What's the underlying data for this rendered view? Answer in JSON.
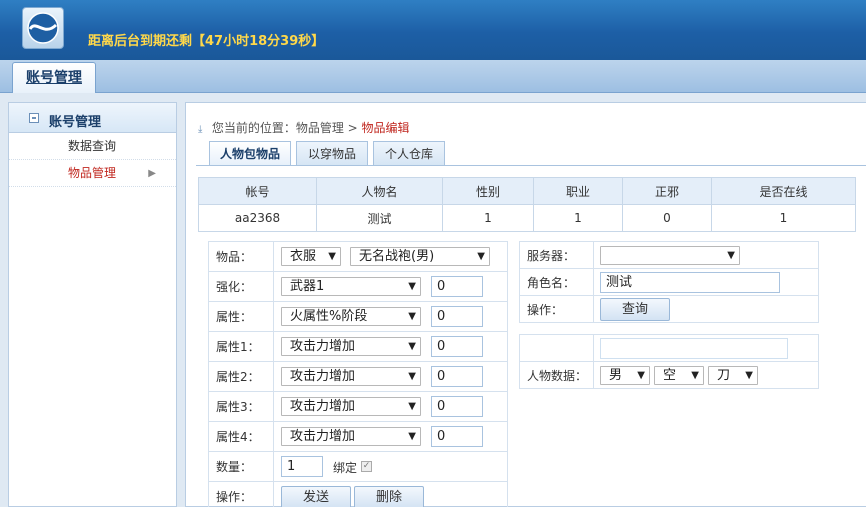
{
  "header": {
    "notice": "距离后台到期还剩【47小时18分39秒】"
  },
  "top_tab": {
    "label": "账号管理"
  },
  "sidebar": {
    "title": "账号管理",
    "items": [
      {
        "label": "数据查询"
      },
      {
        "label": "物品管理"
      }
    ]
  },
  "breadcrumb": {
    "prefix": "您当前的位置：物品管理 > ",
    "current": "物品编辑"
  },
  "sub_tabs": [
    {
      "label": "人物包物品"
    },
    {
      "label": "以穿物品"
    },
    {
      "label": "个人仓库"
    }
  ],
  "char_table": {
    "headers": [
      "帐号",
      "人物名",
      "性别",
      "职业",
      "正邪",
      "是否在线"
    ],
    "row": [
      "aa2368",
      "测试",
      "1",
      "1",
      "0",
      "1"
    ]
  },
  "item_form": {
    "item_label": "物品：",
    "item_type": "衣服",
    "item_name": "无名战袍(男)",
    "enhance_label": "强化：",
    "enhance_select": "武器1",
    "enhance_value": "0",
    "attr_label": "属性：",
    "attr_select": "火属性%阶段",
    "attr_value": "0",
    "attr1_label": "属性1：",
    "attr1_select": "攻击力增加",
    "attr1_value": "0",
    "attr2_label": "属性2：",
    "attr2_select": "攻击力增加",
    "attr2_value": "0",
    "attr3_label": "属性3：",
    "attr3_select": "攻击力增加",
    "attr3_value": "0",
    "attr4_label": "属性4：",
    "attr4_select": "攻击力增加",
    "attr4_value": "0",
    "qty_label": "数量：",
    "qty_value": "1",
    "bind_label": "绑定",
    "op_label": "操作：",
    "send_button": "发送",
    "delete_button": "删除"
  },
  "server_form": {
    "server_label": "服务器：",
    "server_value": "",
    "role_label": "角色名：",
    "role_value": "测试",
    "op_label": "操作：",
    "query_button": "查询"
  },
  "data_form": {
    "top_value": "",
    "label": "人物数据：",
    "gender": "男",
    "status": "空",
    "weapon": "刀"
  }
}
